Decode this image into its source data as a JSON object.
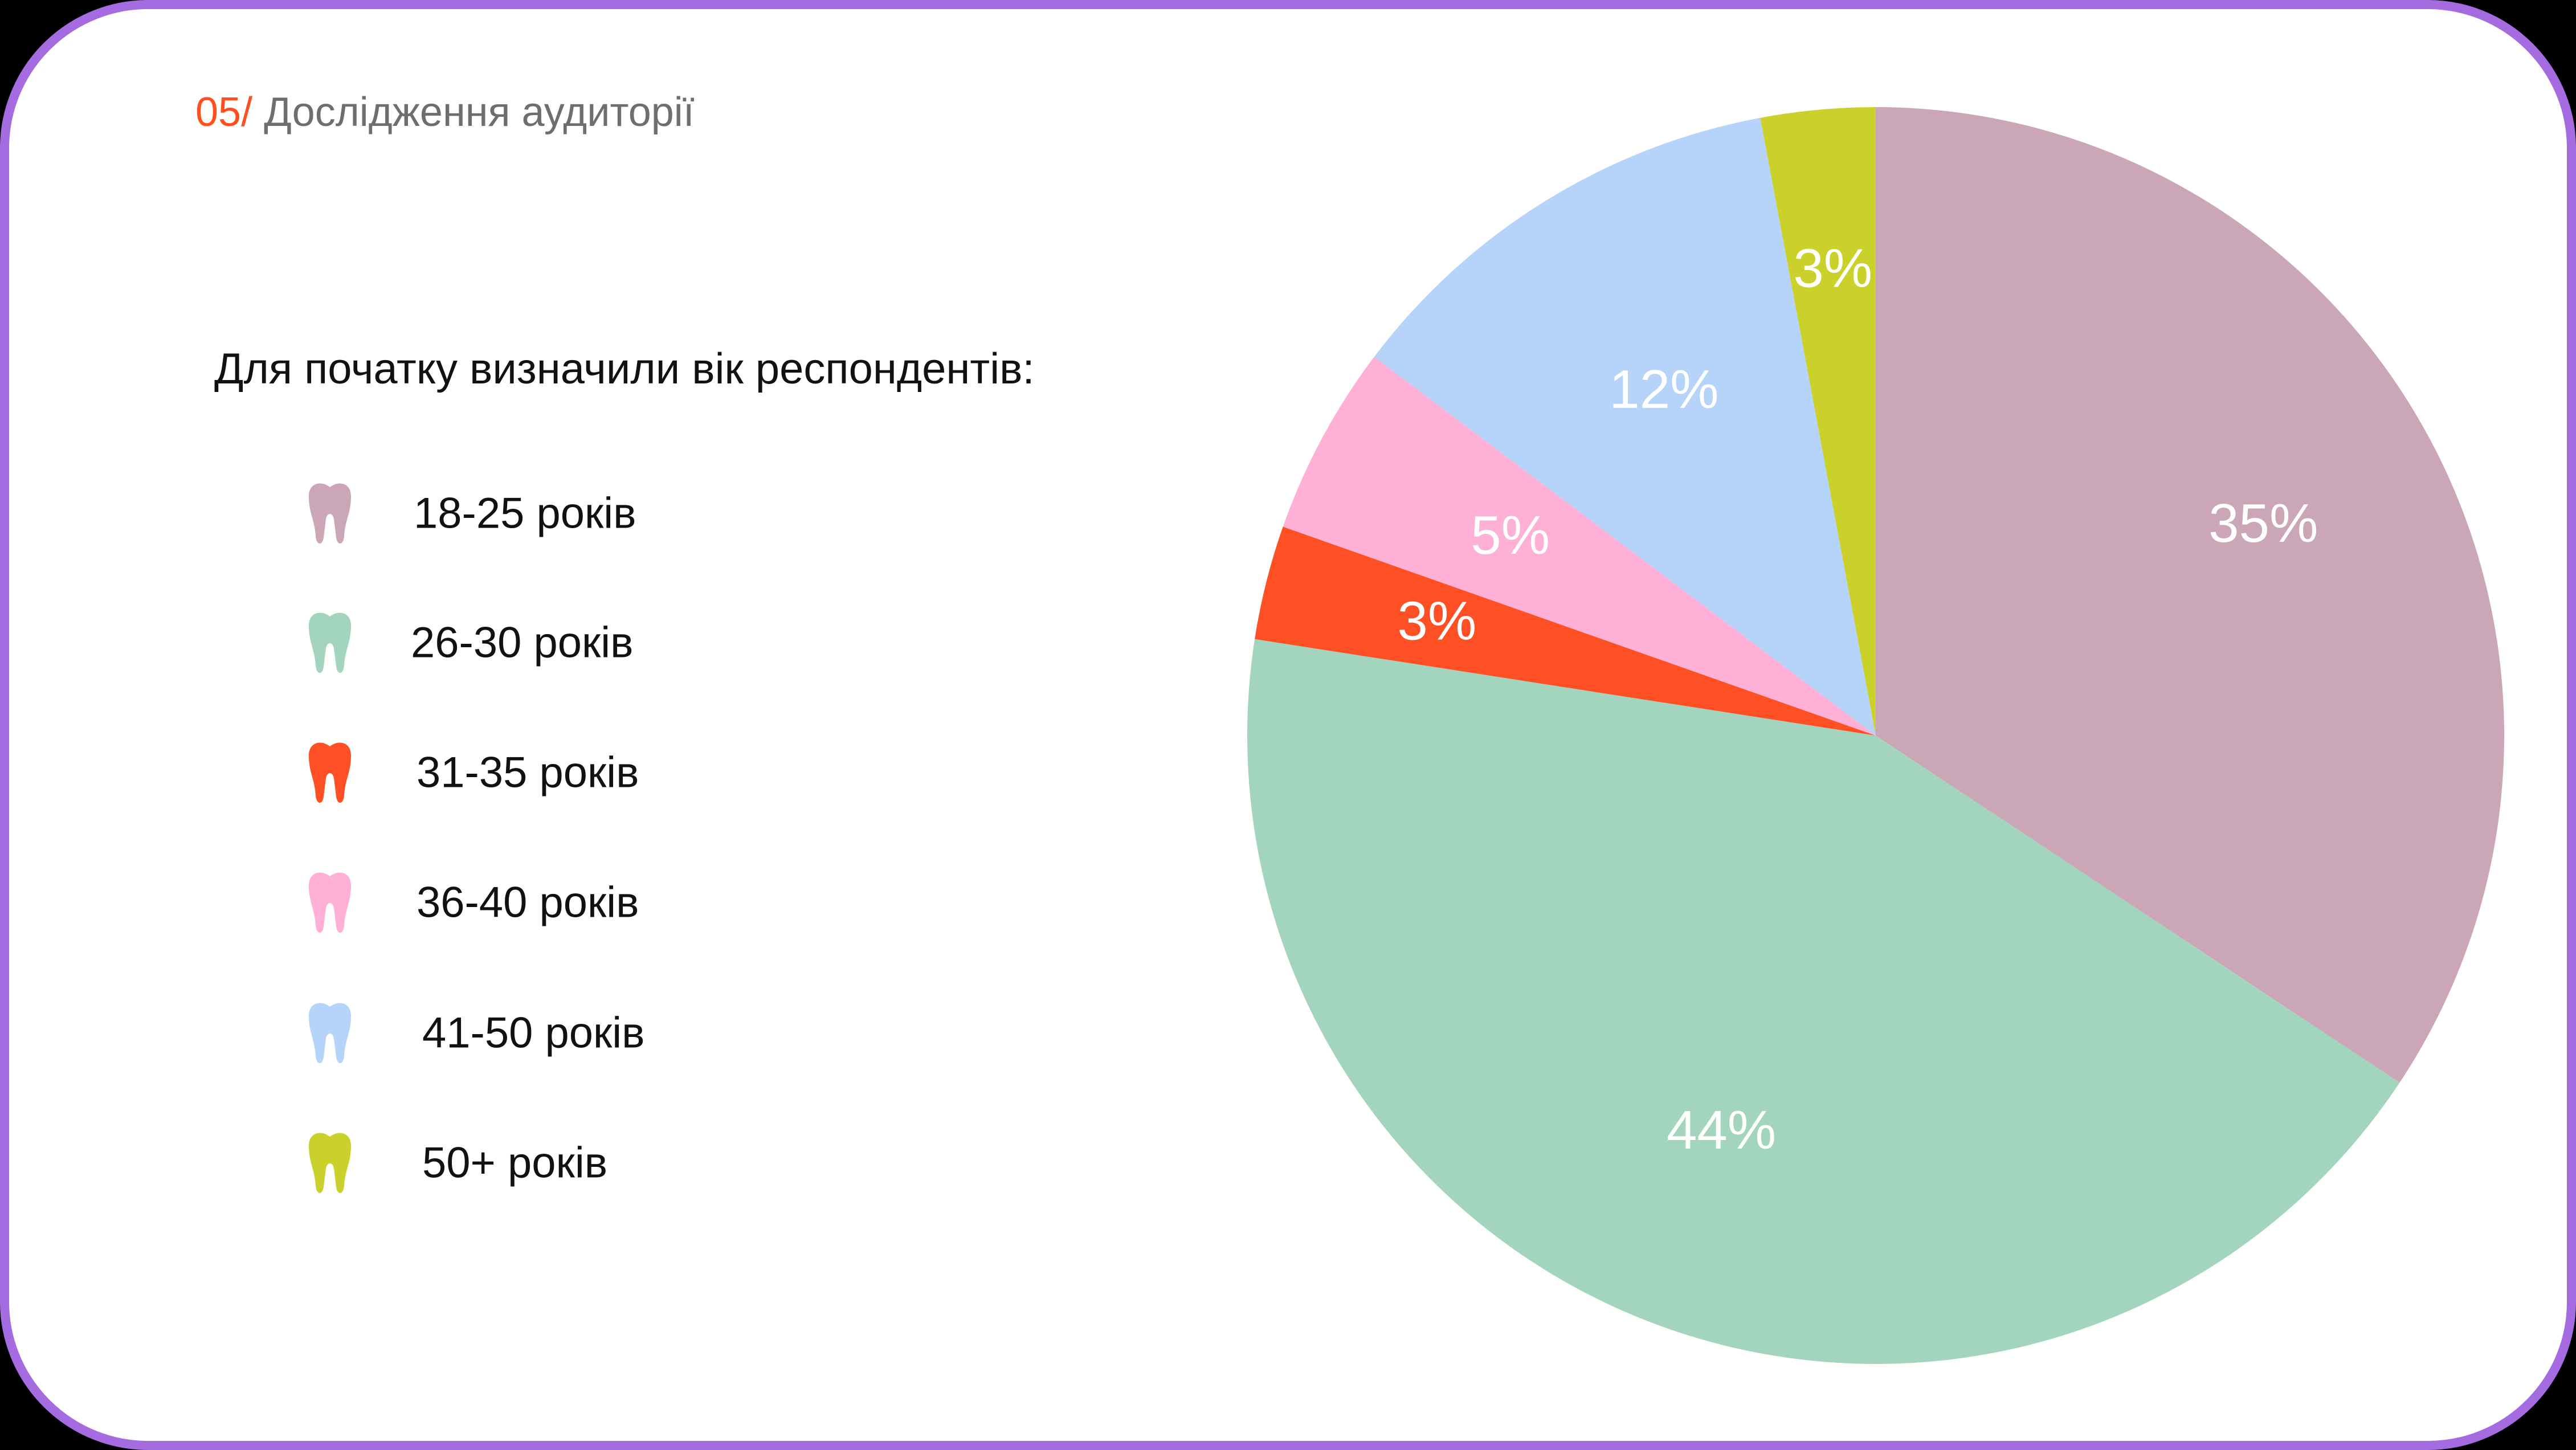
{
  "heading": {
    "number": "05/",
    "title": " Дослідження аудиторії"
  },
  "intro": "Для початку визначили вік респондентів:",
  "legend": [
    {
      "label": "18-25 років",
      "color": "#CAA6B7",
      "icon": "tooth-icon"
    },
    {
      "label": "26-30 років",
      "color": "#A3D4BD",
      "icon": "tooth-icon"
    },
    {
      "label": "31-35 років",
      "color": "#FF4F24",
      "icon": "tooth-icon"
    },
    {
      "label": "36-40 років",
      "color": "#FFB0D6",
      "icon": "tooth-icon"
    },
    {
      "label": "41-50 років",
      "color": "#B6D3FA",
      "icon": "tooth-icon"
    },
    {
      "label": "50+ років",
      "color": "#CBD12B",
      "icon": "tooth-icon"
    }
  ],
  "chart_data": {
    "type": "pie",
    "categories": [
      "18-25 років",
      "26-30 років",
      "31-35 років",
      "36-40 років",
      "41-50 років",
      "50+ років"
    ],
    "values": [
      35,
      44,
      3,
      5,
      12,
      3
    ],
    "labels": [
      "35%",
      "44%",
      "3%",
      "5%",
      "12%",
      "3%"
    ],
    "colors": [
      "#CAA6B7",
      "#A3D4BD",
      "#FF4F24",
      "#FFB0D6",
      "#B6D3FA",
      "#CBD12B"
    ],
    "start": "12 o'clock",
    "direction": "clockwise"
  }
}
